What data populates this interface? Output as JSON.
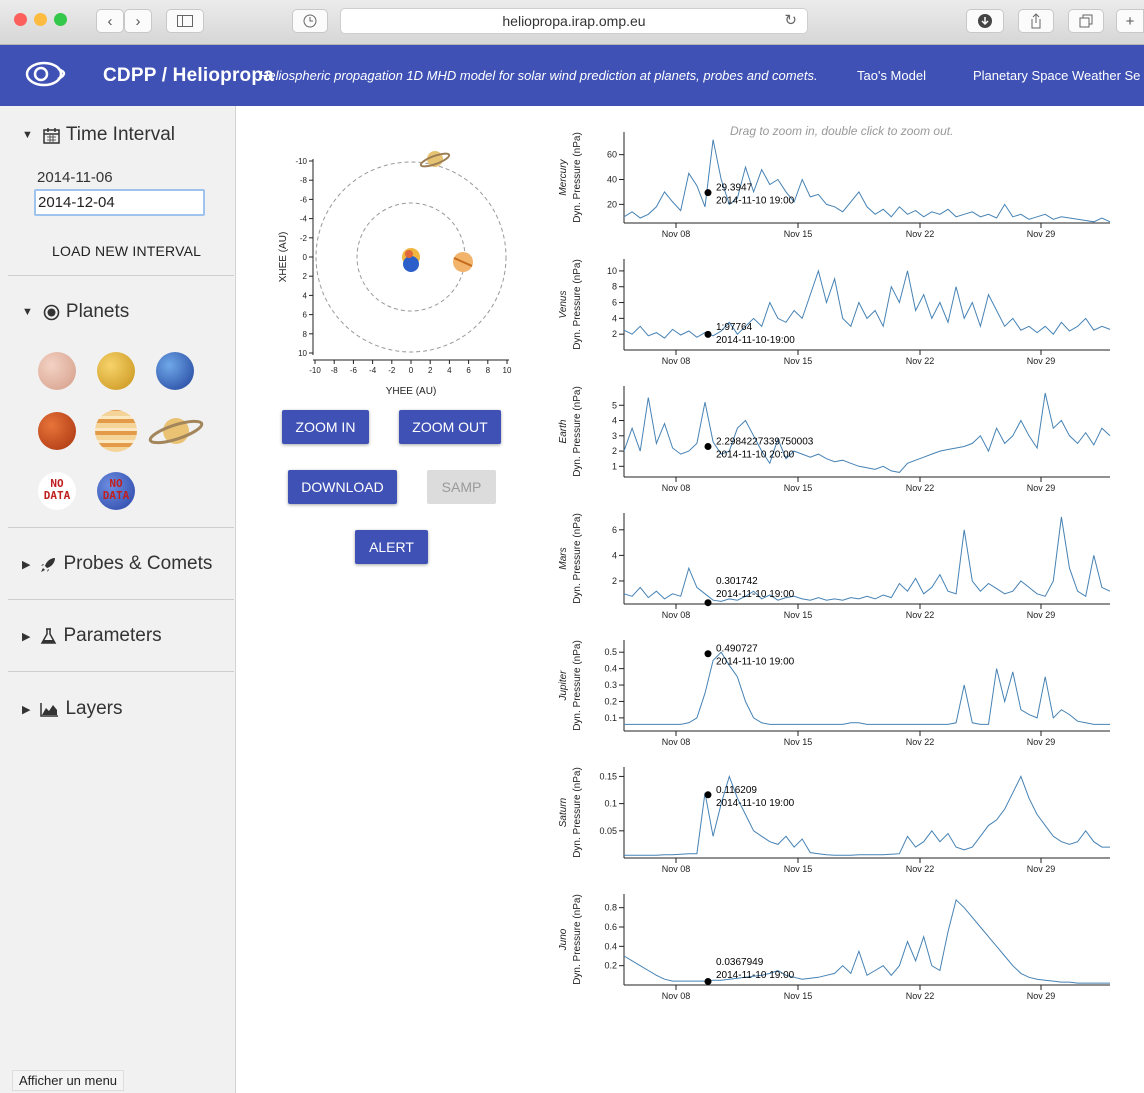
{
  "browser": {
    "url": "heliopropa.irap.omp.eu"
  },
  "header": {
    "brand": "CDPP / Heliopropa",
    "subtitle": "Heliospheric propagation 1D MHD model for solar wind prediction at planets, probes and comets.",
    "nav": [
      "Tao's Model",
      "Planetary Space Weather Se"
    ]
  },
  "sidebar": {
    "time_interval": {
      "title": "Time Interval",
      "start": "2014-11-06",
      "end": "2014-12-04",
      "load_label": "LOAD NEW INTERVAL"
    },
    "planets": {
      "title": "Planets",
      "no_data_label": "NO DATA"
    },
    "sections": [
      "Probes & Comets",
      "Parameters",
      "Layers"
    ]
  },
  "tooltip": "Afficher un menu",
  "orbit": {
    "x_label": "XHEE (AU)",
    "y_label": "YHEE (AU)",
    "ticks_y": [
      "-10",
      "-8",
      "-6",
      "-4",
      "-2",
      "0",
      "2",
      "4",
      "6",
      "8",
      "10"
    ],
    "ticks_x": [
      "-10",
      "-8",
      "-6",
      "-4",
      "-2",
      "0",
      "2",
      "4",
      "6",
      "8",
      "10"
    ]
  },
  "buttons": {
    "zoom_in": "ZOOM IN",
    "zoom_out": "ZOOM OUT",
    "download": "DOWNLOAD",
    "samp": "SAMP",
    "alert": "ALERT"
  },
  "hint": "Drag to zoom in, double click to zoom out.",
  "colors": {
    "primary": "#3f51b5",
    "line": "#4682b4",
    "sidebar": "#f1f1f1"
  },
  "chart_data": [
    {
      "type": "line",
      "name": "Mercury",
      "ylabel": "Dyn. Pressure (nPa)",
      "yticks": [
        20,
        40,
        60
      ],
      "ylim": [
        5,
        75
      ],
      "x_ticks": [
        "Nov 08",
        "Nov 15",
        "Nov 22",
        "Nov 29"
      ],
      "marker": {
        "value": "29.3947",
        "date": "2014-11-10 19:00"
      },
      "values": [
        10,
        14,
        9,
        12,
        18,
        30,
        22,
        15,
        45,
        35,
        18,
        72,
        40,
        20,
        25,
        50,
        30,
        48,
        36,
        40,
        30,
        22,
        40,
        26,
        28,
        20,
        18,
        14,
        22,
        30,
        18,
        12,
        16,
        10,
        18,
        12,
        15,
        10,
        14,
        12,
        16,
        10,
        12,
        14,
        10,
        12,
        9,
        20,
        10,
        12,
        8,
        10,
        12,
        8,
        10,
        9,
        8,
        7,
        6,
        9,
        6
      ]
    },
    {
      "type": "line",
      "name": "Venus",
      "ylabel": "Dyn. Pressure (nPa)",
      "yticks": [
        2,
        4,
        6,
        8,
        10
      ],
      "ylim": [
        0,
        11
      ],
      "x_ticks": [
        "Nov 08",
        "Nov 15",
        "Nov 22",
        "Nov 29"
      ],
      "marker": {
        "value": "1:97764",
        "date": "2014-11-10-19:00"
      },
      "values": [
        2.5,
        2,
        3,
        1.8,
        2.2,
        1.5,
        2.6,
        1.9,
        2.4,
        1.6,
        2.2,
        1.8,
        2.4,
        3.5,
        2,
        3,
        4,
        3,
        6,
        4,
        3.5,
        5,
        4,
        7,
        10,
        6,
        9,
        4,
        3,
        6,
        4,
        5,
        3,
        8,
        6,
        10,
        5,
        7,
        4,
        6,
        3.5,
        8,
        4,
        6,
        3,
        7,
        5,
        3,
        4,
        2.5,
        3,
        2.2,
        3,
        2,
        3.5,
        2.4,
        3,
        4,
        2.5,
        3,
        2.6
      ]
    },
    {
      "type": "line",
      "name": "Earth",
      "ylabel": "Dyn. Pressure (nPa)",
      "yticks": [
        1,
        2,
        3,
        4,
        5
      ],
      "ylim": [
        0.3,
        6
      ],
      "x_ticks": [
        "Nov 08",
        "Nov 15",
        "Nov 22",
        "Nov 29"
      ],
      "marker": {
        "value": "2.2984227339750003",
        "date": "2014-11-10 20:00"
      },
      "values": [
        2,
        3.5,
        2,
        5.5,
        2.5,
        3.8,
        2.2,
        1.8,
        2,
        2.5,
        5.2,
        2.6,
        1.8,
        2,
        3.5,
        4,
        3,
        2,
        1.2,
        2.8,
        1.5,
        2,
        1.8,
        1.6,
        1.8,
        1.5,
        1.3,
        1.4,
        1.2,
        1,
        0.9,
        0.8,
        1,
        0.7,
        0.6,
        1.2,
        1.4,
        1.6,
        1.8,
        2,
        2.1,
        2.2,
        2.3,
        2.5,
        3,
        2,
        3.5,
        2.5,
        3,
        4,
        3,
        2.2,
        5.8,
        3.5,
        4,
        3,
        2.5,
        3.2,
        2.4,
        3.5,
        3
      ]
    },
    {
      "type": "line",
      "name": "Mars",
      "ylabel": "Dyn. Pressure (nPa)",
      "yticks": [
        2,
        4,
        6
      ],
      "ylim": [
        0.2,
        7
      ],
      "x_ticks": [
        "Nov 08",
        "Nov 15",
        "Nov 22",
        "Nov 29"
      ],
      "marker": {
        "value": "0.301742",
        "date": "2014-11-10 19:00"
      },
      "values": [
        1,
        0.8,
        1.5,
        0.7,
        1.2,
        0.6,
        1,
        0.8,
        3,
        1.5,
        1,
        0.5,
        0.4,
        0.6,
        0.5,
        0.8,
        1.2,
        0.6,
        0.9,
        0.5,
        0.7,
        0.8,
        0.6,
        0.5,
        0.7,
        0.5,
        0.6,
        0.5,
        0.7,
        0.6,
        0.8,
        0.6,
        0.9,
        0.7,
        1.8,
        1.2,
        2.2,
        1,
        1.5,
        2.5,
        1.2,
        1,
        6,
        2,
        1.2,
        1.8,
        1.4,
        1,
        1.2,
        2,
        1.5,
        1,
        0.8,
        2,
        7,
        3,
        1.2,
        0.8,
        4,
        1.5,
        1.2
      ]
    },
    {
      "type": "line",
      "name": "Jupiter",
      "ylabel": "Dyn. Pressure (nPa)",
      "yticks": [
        0.1,
        0.2,
        0.3,
        0.4,
        0.5
      ],
      "ylim": [
        0.02,
        0.55
      ],
      "x_ticks": [
        "Nov 08",
        "Nov 15",
        "Nov 22",
        "Nov 29"
      ],
      "marker": {
        "value": "0.490727",
        "date": "2014-11-10 19:00"
      },
      "values": [
        0.06,
        0.06,
        0.06,
        0.06,
        0.06,
        0.06,
        0.06,
        0.06,
        0.07,
        0.1,
        0.25,
        0.45,
        0.5,
        0.42,
        0.35,
        0.2,
        0.1,
        0.07,
        0.06,
        0.06,
        0.06,
        0.06,
        0.06,
        0.06,
        0.06,
        0.06,
        0.06,
        0.06,
        0.07,
        0.07,
        0.06,
        0.06,
        0.06,
        0.06,
        0.06,
        0.06,
        0.06,
        0.06,
        0.06,
        0.06,
        0.06,
        0.07,
        0.3,
        0.07,
        0.06,
        0.06,
        0.4,
        0.2,
        0.38,
        0.15,
        0.12,
        0.1,
        0.35,
        0.1,
        0.15,
        0.12,
        0.08,
        0.07,
        0.06,
        0.06,
        0.06
      ]
    },
    {
      "type": "line",
      "name": "Saturn",
      "ylabel": "Dyn. Pressure (nPa)",
      "yticks": [
        0.05,
        0.1,
        0.15
      ],
      "ylim": [
        0,
        0.16
      ],
      "x_ticks": [
        "Nov 08",
        "Nov 15",
        "Nov 22",
        "Nov 29"
      ],
      "marker": {
        "value": "0.116209",
        "date": "2014-11-10 19:00"
      },
      "values": [
        0.005,
        0.005,
        0.005,
        0.005,
        0.005,
        0.006,
        0.006,
        0.007,
        0.008,
        0.008,
        0.12,
        0.04,
        0.1,
        0.15,
        0.11,
        0.08,
        0.05,
        0.04,
        0.03,
        0.025,
        0.04,
        0.02,
        0.035,
        0.01,
        0.008,
        0.006,
        0.005,
        0.005,
        0.005,
        0.006,
        0.006,
        0.006,
        0.006,
        0.007,
        0.008,
        0.04,
        0.02,
        0.03,
        0.05,
        0.03,
        0.045,
        0.02,
        0.015,
        0.02,
        0.04,
        0.06,
        0.07,
        0.09,
        0.12,
        0.15,
        0.11,
        0.08,
        0.06,
        0.04,
        0.03,
        0.025,
        0.03,
        0.05,
        0.03,
        0.02,
        0.02
      ]
    },
    {
      "type": "line",
      "name": "Juno",
      "ylabel": "Dyn. Pressure (nPa)",
      "yticks": [
        0.2,
        0.4,
        0.6,
        0.8
      ],
      "ylim": [
        0,
        0.9
      ],
      "x_ticks": [
        "Nov 08",
        "Nov 15",
        "Nov 22",
        "Nov 29"
      ],
      "marker": {
        "value": "0.0367949",
        "date": "2014-11-10 19:00"
      },
      "values": [
        0.3,
        0.25,
        0.2,
        0.15,
        0.1,
        0.06,
        0.04,
        0.04,
        0.04,
        0.04,
        0.04,
        0.05,
        0.05,
        0.06,
        0.07,
        0.08,
        0.09,
        0.1,
        0.12,
        0.15,
        0.1,
        0.08,
        0.06,
        0.07,
        0.08,
        0.1,
        0.12,
        0.2,
        0.12,
        0.35,
        0.1,
        0.15,
        0.2,
        0.1,
        0.2,
        0.45,
        0.25,
        0.5,
        0.2,
        0.15,
        0.55,
        0.88,
        0.8,
        0.7,
        0.6,
        0.5,
        0.4,
        0.3,
        0.2,
        0.12,
        0.08,
        0.06,
        0.05,
        0.04,
        0.03,
        0.03,
        0.02,
        0.02,
        0.02,
        0.02,
        0.02
      ]
    }
  ]
}
